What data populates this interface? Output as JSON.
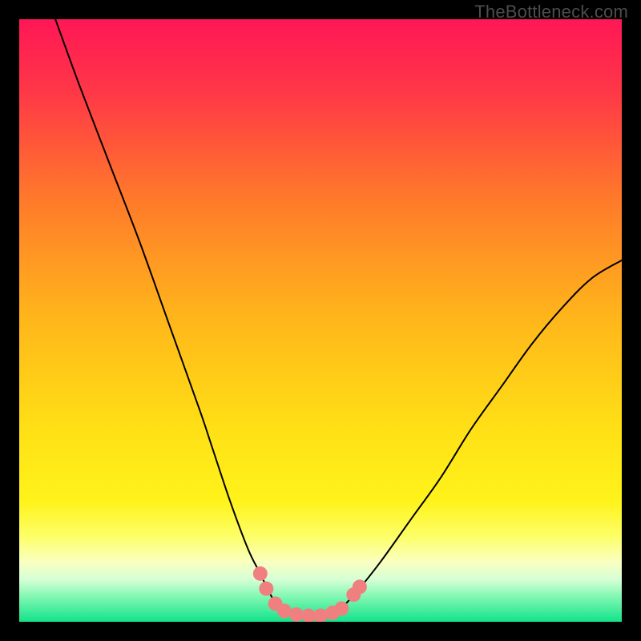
{
  "watermark": "TheBottleneck.com",
  "chart_data": {
    "type": "line",
    "title": "",
    "xlabel": "",
    "ylabel": "",
    "xlim": [
      0,
      100
    ],
    "ylim": [
      0,
      100
    ],
    "grid": false,
    "legend": false,
    "background_gradient": {
      "stops": [
        {
          "t": 0.0,
          "color": "#ff1756"
        },
        {
          "t": 0.12,
          "color": "#ff3747"
        },
        {
          "t": 0.3,
          "color": "#ff7a2a"
        },
        {
          "t": 0.5,
          "color": "#ffb71a"
        },
        {
          "t": 0.68,
          "color": "#ffe016"
        },
        {
          "t": 0.8,
          "color": "#fff31a"
        },
        {
          "t": 0.86,
          "color": "#fdff6a"
        },
        {
          "t": 0.9,
          "color": "#faffc0"
        },
        {
          "t": 0.93,
          "color": "#d6ffd6"
        },
        {
          "t": 0.96,
          "color": "#7cf7b0"
        },
        {
          "t": 1.0,
          "color": "#13e28a"
        }
      ]
    },
    "series": [
      {
        "name": "bottleneck-curve",
        "color": "#000000",
        "stroke_width": 2,
        "x": [
          6,
          10,
          15,
          20,
          25,
          30,
          32,
          35,
          38,
          40,
          42,
          44,
          46,
          48,
          50,
          53,
          56,
          60,
          65,
          70,
          75,
          80,
          85,
          90,
          95,
          100
        ],
        "y": [
          100,
          89,
          76,
          63,
          49,
          35,
          29,
          20,
          12,
          8,
          4,
          2,
          1,
          1,
          1,
          2,
          5,
          10,
          17,
          24,
          32,
          39,
          46,
          52,
          57,
          60
        ]
      }
    ],
    "markers": {
      "name": "highlight-segment",
      "color": "#f08080",
      "radius": 9,
      "points": [
        {
          "x": 40.0,
          "y": 8.0
        },
        {
          "x": 41.0,
          "y": 5.5
        },
        {
          "x": 42.5,
          "y": 3.0
        },
        {
          "x": 44.0,
          "y": 1.8
        },
        {
          "x": 46.0,
          "y": 1.2
        },
        {
          "x": 48.0,
          "y": 1.0
        },
        {
          "x": 50.0,
          "y": 1.0
        },
        {
          "x": 52.0,
          "y": 1.5
        },
        {
          "x": 53.5,
          "y": 2.2
        },
        {
          "x": 55.5,
          "y": 4.5
        },
        {
          "x": 56.5,
          "y": 5.8
        }
      ]
    }
  }
}
